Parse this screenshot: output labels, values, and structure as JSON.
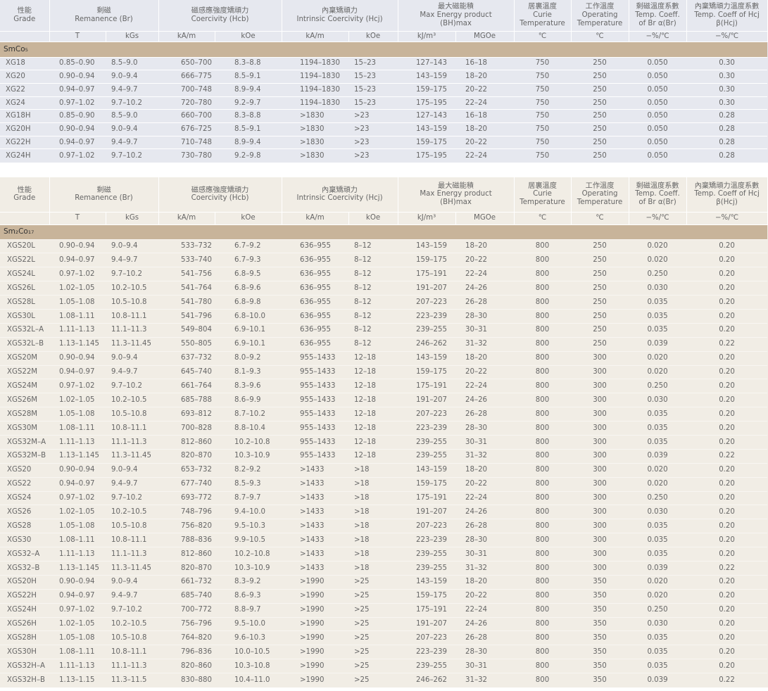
{
  "headers": {
    "grade_cn": "性能",
    "grade_en": "Grade",
    "br_cn": "剩磁",
    "br_en": "Remanence (Br)",
    "hcb_cn": "磁感應強度矯頑力",
    "hcb_en": "Coercivity (Hcb)",
    "hcj_cn": "內稟矯頑力",
    "hcj_en": "Intrinsic Coercivity (Hcj)",
    "bh_cn": "最大磁能積",
    "bh_en1": "Max Energy product",
    "bh_en2": "(BH)max",
    "curie_cn": "居裏溫度",
    "curie_en1": "Curie",
    "curie_en2": "Temperature",
    "op_cn": "工作溫度",
    "op_en1": "Operating",
    "op_en2": "Temperature",
    "abr_cn": "剩磁溫度系數",
    "abr_en1": "Temp. Coeff.",
    "abr_en2": "of Br  α(Br)",
    "bhcj_cn": "內稟矯頑力溫度系數",
    "bhcj_en1": "Temp. Coeff of Hcj",
    "bhcj_en2": "β(Hcj)",
    "units": [
      "T",
      "kGs",
      "kA/m",
      "kOe",
      "kA/m",
      "kOe",
      "kJ/m³",
      "MGOe",
      "℃",
      "℃",
      "−%/℃",
      "−%/℃"
    ]
  },
  "table1": {
    "section": "SmCo₅",
    "rows": [
      [
        "XG18",
        "0.85–0.90",
        "8.5–9.0",
        "650–700",
        "8.3–8.8",
        "1194–1830",
        "15–23",
        "127–143",
        "16–18",
        "750",
        "250",
        "0.050",
        "0.30"
      ],
      [
        "XG20",
        "0.90–0.94",
        "9.0–9.4",
        "666–775",
        "8.5–9.1",
        "1194–1830",
        "15–23",
        "143–159",
        "18–20",
        "750",
        "250",
        "0.050",
        "0.30"
      ],
      [
        "XG22",
        "0.94–0.97",
        "9.4–9.7",
        "700–748",
        "8.9–9.4",
        "1194–1830",
        "15–23",
        "159–175",
        "20–22",
        "750",
        "250",
        "0.050",
        "0.30"
      ],
      [
        "XG24",
        "0.97–1.02",
        "9.7–10.2",
        "720–780",
        "9.2–9.7",
        "1194–1830",
        "15–23",
        "175–195",
        "22–24",
        "750",
        "250",
        "0.050",
        "0.30"
      ],
      [
        "XG18H",
        "0.85–0.90",
        "8.5–9.0",
        "660–700",
        "8.3–8.8",
        ">1830",
        ">23",
        "127–143",
        "16–18",
        "750",
        "250",
        "0.050",
        "0.28"
      ],
      [
        "XG20H",
        "0.90–0.94",
        "9.0–9.4",
        "676–725",
        "8.5–9.1",
        ">1830",
        ">23",
        "143–159",
        "18–20",
        "750",
        "250",
        "0.050",
        "0.28"
      ],
      [
        "XG22H",
        "0.94–0.97",
        "9.4–9.7",
        "710–748",
        "8.9–9.4",
        ">1830",
        ">23",
        "159–175",
        "20–22",
        "750",
        "250",
        "0.050",
        "0.28"
      ],
      [
        "XG24H",
        "0.97–1.02",
        "9.7–10.2",
        "730–780",
        "9.2–9.8",
        ">1830",
        ">23",
        "175–195",
        "22–24",
        "750",
        "250",
        "0.050",
        "0.28"
      ]
    ]
  },
  "table2": {
    "section": "Sm₂Co₁₇",
    "rows": [
      [
        "XGS20L",
        "0.90–0.94",
        "9.0–9.4",
        "533–732",
        "6.7–9.2",
        "636–955",
        "8–12",
        "143–159",
        "18–20",
        "800",
        "250",
        "0.020",
        "0.20"
      ],
      [
        "XGS22L",
        "0.94–0.97",
        "9.4–9.7",
        "533–740",
        "6.7–9.3",
        "636–955",
        "8–12",
        "159–175",
        "20–22",
        "800",
        "250",
        "0.020",
        "0.20"
      ],
      [
        "XGS24L",
        "0.97–1.02",
        "9.7–10.2",
        "541–756",
        "6.8–9.5",
        "636–955",
        "8–12",
        "175–191",
        "22–24",
        "800",
        "250",
        "0.250",
        "0.20"
      ],
      [
        "XGS26L",
        "1.02–1.05",
        "10.2–10.5",
        "541–764",
        "6.8–9.6",
        "636–955",
        "8–12",
        "191–207",
        "24–26",
        "800",
        "250",
        "0.030",
        "0.20"
      ],
      [
        "XGS28L",
        "1.05–1.08",
        "10.5–10.8",
        "541–780",
        "6.8–9.8",
        "636–955",
        "8–12",
        "207–223",
        "26–28",
        "800",
        "250",
        "0.035",
        "0.20"
      ],
      [
        "XGS30L",
        "1.08–1.11",
        "10.8–11.1",
        "541–796",
        "6.8–10.0",
        "636–955",
        "8–12",
        "223–239",
        "28–30",
        "800",
        "250",
        "0.035",
        "0.20"
      ],
      [
        "XGS32L–A",
        "1.11–1.13",
        "11.1–11.3",
        "549–804",
        "6.9–10.1",
        "636–955",
        "8–12",
        "239–255",
        "30–31",
        "800",
        "250",
        "0.035",
        "0.20"
      ],
      [
        "XGS32L–B",
        "1.13–1.145",
        "11.3–11.45",
        "550–805",
        "6.9–10.1",
        "636–955",
        "8–12",
        "246–262",
        "31–32",
        "800",
        "250",
        "0.039",
        "0.22"
      ],
      [
        "XGS20M",
        "0.90–0.94",
        "9.0–9.4",
        "637–732",
        "8.0–9.2",
        "955–1433",
        "12–18",
        "143–159",
        "18–20",
        "800",
        "300",
        "0.020",
        "0.20"
      ],
      [
        "XGS22M",
        "0.94–0.97",
        "9.4–9.7",
        "645–740",
        "8.1–9.3",
        "955–1433",
        "12–18",
        "159–175",
        "20–22",
        "800",
        "300",
        "0.020",
        "0.20"
      ],
      [
        "XGS24M",
        "0.97–1.02",
        "9.7–10.2",
        "661–764",
        "8.3–9.6",
        "955–1433",
        "12–18",
        "175–191",
        "22–24",
        "800",
        "300",
        "0.250",
        "0.20"
      ],
      [
        "XGS26M",
        "1.02–1.05",
        "10.2–10.5",
        "685–788",
        "8.6–9.9",
        "955–1433",
        "12–18",
        "191–207",
        "24–26",
        "800",
        "300",
        "0.030",
        "0.20"
      ],
      [
        "XGS28M",
        "1.05–1.08",
        "10.5–10.8",
        "693–812",
        "8.7–10.2",
        "955–1433",
        "12–18",
        "207–223",
        "26–28",
        "800",
        "300",
        "0.035",
        "0.20"
      ],
      [
        "XGS30M",
        "1.08–1.11",
        "10.8–11.1",
        "700–828",
        "8.8–10.4",
        "955–1433",
        "12–18",
        "223–239",
        "28–30",
        "800",
        "300",
        "0.035",
        "0.20"
      ],
      [
        "XGS32M–A",
        "1.11–1.13",
        "11.1–11.3",
        "812–860",
        "10.2–10.8",
        "955–1433",
        "12–18",
        "239–255",
        "30–31",
        "800",
        "300",
        "0.035",
        "0.20"
      ],
      [
        "XGS32M–B",
        "1.13–1.145",
        "11.3–11.45",
        "820–870",
        "10.3–10.9",
        "955–1433",
        "12–18",
        "239–255",
        "31–32",
        "800",
        "300",
        "0.039",
        "0.22"
      ],
      [
        "XGS20",
        "0.90–0.94",
        "9.0–9.4",
        "653–732",
        "8.2–9.2",
        ">1433",
        ">18",
        "143–159",
        "18–20",
        "800",
        "300",
        "0.020",
        "0.20"
      ],
      [
        "XGS22",
        "0.94–0.97",
        "9.4–9.7",
        "677–740",
        "8.5–9.3",
        ">1433",
        ">18",
        "159–175",
        "20–22",
        "800",
        "300",
        "0.020",
        "0.20"
      ],
      [
        "XGS24",
        "0.97–1.02",
        "9.7–10.2",
        "693–772",
        "8.7–9.7",
        ">1433",
        ">18",
        "175–191",
        "22–24",
        "800",
        "300",
        "0.250",
        "0.20"
      ],
      [
        "XGS26",
        "1.02–1.05",
        "10.2–10.5",
        "748–796",
        "9.4–10.0",
        ">1433",
        ">18",
        "191–207",
        "24–26",
        "800",
        "300",
        "0.030",
        "0.20"
      ],
      [
        "XGS28",
        "1.05–1.08",
        "10.5–10.8",
        "756–820",
        "9.5–10.3",
        ">1433",
        ">18",
        "207–223",
        "26–28",
        "800",
        "300",
        "0.035",
        "0.20"
      ],
      [
        "XGS30",
        "1.08–1.11",
        "10.8–11.1",
        "788–836",
        "9.9–10.5",
        ">1433",
        ">18",
        "223–239",
        "28–30",
        "800",
        "300",
        "0.035",
        "0.20"
      ],
      [
        "XGS32–A",
        "1.11–1.13",
        "11.1–11.3",
        "812–860",
        "10.2–10.8",
        ">1433",
        ">18",
        "239–255",
        "30–31",
        "800",
        "300",
        "0.035",
        "0.20"
      ],
      [
        "XGS32–B",
        "1.13–1.145",
        "11.3–11.45",
        "820–870",
        "10.3–10.9",
        ">1433",
        ">18",
        "239–255",
        "31–32",
        "800",
        "300",
        "0.039",
        "0.22"
      ],
      [
        "XGS20H",
        "0.90–0.94",
        "9.0–9.4",
        "661–732",
        "8.3–9.2",
        ">1990",
        ">25",
        "143–159",
        "18–20",
        "800",
        "350",
        "0.020",
        "0.20"
      ],
      [
        "XGS22H",
        "0.94–0.97",
        "9.4–9.7",
        "685–740",
        "8.6–9.3",
        ">1990",
        ">25",
        "159–175",
        "20–22",
        "800",
        "350",
        "0.020",
        "0.20"
      ],
      [
        "XGS24H",
        "0.97–1.02",
        "9.7–10.2",
        "700–772",
        "8.8–9.7",
        ">1990",
        ">25",
        "175–191",
        "22–24",
        "800",
        "350",
        "0.250",
        "0.20"
      ],
      [
        "XGS26H",
        "1.02–1.05",
        "10.2–10.5",
        "756–796",
        "9.5–10.0",
        ">1990",
        ">25",
        "191–207",
        "24–26",
        "800",
        "350",
        "0.030",
        "0.20"
      ],
      [
        "XGS28H",
        "1.05–1.08",
        "10.5–10.8",
        "764–820",
        "9.6–10.3",
        ">1990",
        ">25",
        "207–223",
        "26–28",
        "800",
        "350",
        "0.035",
        "0.20"
      ],
      [
        "XGS30H",
        "1.08–1.11",
        "10.8–11.1",
        "796–836",
        "10.0–10.5",
        ">1990",
        ">25",
        "223–239",
        "28–30",
        "800",
        "350",
        "0.035",
        "0.20"
      ],
      [
        "XGS32H–A",
        "1.11–1.13",
        "11.1–11.3",
        "820–860",
        "10.3–10.8",
        ">1990",
        ">25",
        "239–255",
        "30–31",
        "800",
        "350",
        "0.035",
        "0.20"
      ],
      [
        "XGS32H–B",
        "1.13–1.15",
        "11.3–11.5",
        "830–880",
        "10.4–11.0",
        ">1990",
        ">25",
        "246–262",
        "31–32",
        "800",
        "350",
        "0.039",
        "0.22"
      ]
    ]
  }
}
